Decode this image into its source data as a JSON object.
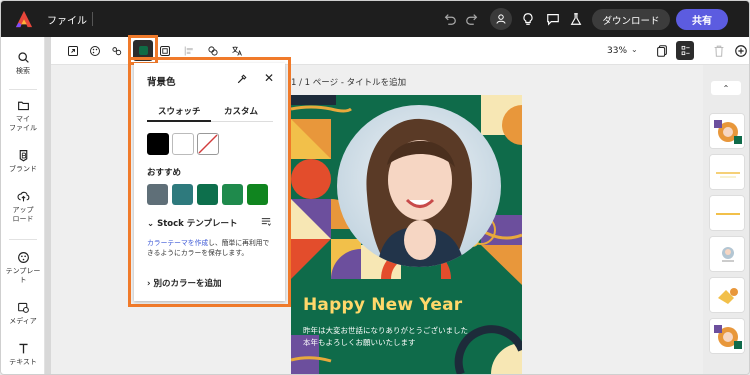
{
  "topbar": {
    "file_label": "ファイル",
    "download_label": "ダウンロード",
    "share_label": "共有"
  },
  "sidebar": {
    "items": [
      {
        "label": "検索",
        "icon": "search-icon"
      },
      {
        "label": "マイ\nファイル",
        "icon": "folder-icon"
      },
      {
        "label": "ブランド",
        "icon": "brand-icon"
      },
      {
        "label": "アップ\nロード",
        "icon": "upload-icon"
      },
      {
        "label": "テンプレー\nト",
        "icon": "template-icon"
      },
      {
        "label": "メディア",
        "icon": "media-icon"
      },
      {
        "label": "テキスト",
        "icon": "text-icon"
      }
    ]
  },
  "toolbar": {
    "zoom": "33%",
    "background_color": "#0f6b45"
  },
  "canvas": {
    "breadcrumb": "1 / 1 ページ - タイトルを追加",
    "card_title": "Happy New Year",
    "message_line1": "昨年は大変お世話になりありがとうございました",
    "message_line2": "本年もよろしくお願いいたします"
  },
  "popover": {
    "title": "背景色",
    "tabs": [
      "スウォッチ",
      "カスタム"
    ],
    "active_tab": "スウォッチ",
    "swatches": [
      "#000000",
      "#ffffff",
      "none"
    ],
    "recommended_label": "おすすめ",
    "recommended": [
      "#5f6f78",
      "#2e7a7d",
      "#0d6f4c",
      "#1f8a4c",
      "#10851f"
    ],
    "stock_label": "Stock テンプレート",
    "help_link": "カラーテーマを作成",
    "help_text": "し、簡単に再利用できるようにカラーを保存します。",
    "add_color_label": "別のカラーを追加"
  },
  "colors": {
    "accent": "#5c5ce0",
    "highlight": "#f07a2a",
    "card_green": "#0f6b4a",
    "card_yellow": "#ffd86a"
  }
}
